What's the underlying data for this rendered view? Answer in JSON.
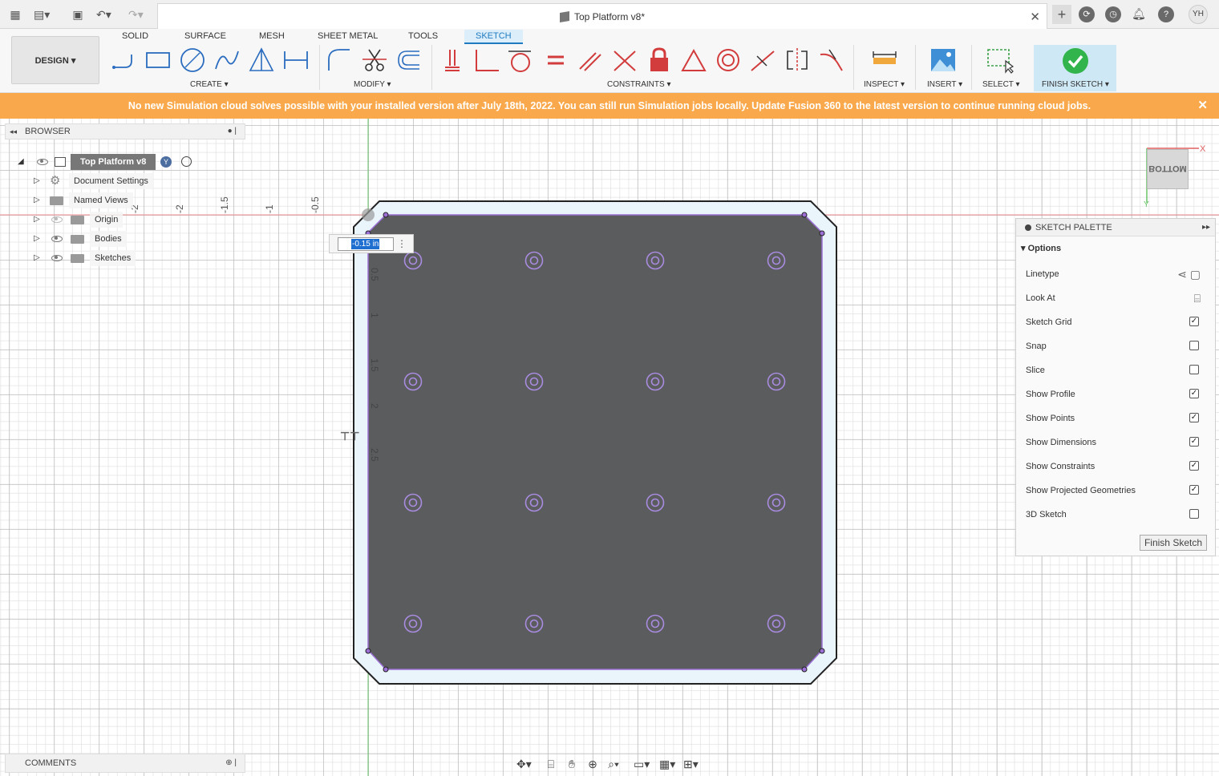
{
  "document": {
    "title": "Top Platform v8*"
  },
  "user": {
    "initials": "YH"
  },
  "workspace": {
    "mode": "DESIGN"
  },
  "tabs": [
    "SOLID",
    "SURFACE",
    "MESH",
    "SHEET METAL",
    "TOOLS",
    "SKETCH"
  ],
  "toolbar_groups": {
    "create": "CREATE",
    "modify": "MODIFY",
    "constraints": "CONSTRAINTS",
    "inspect": "INSPECT",
    "insert": "INSERT",
    "select": "SELECT",
    "finish": "FINISH SKETCH"
  },
  "banner": {
    "message": "No new Simulation cloud solves possible with your installed version after July 18th, 2022. You can still run Simulation jobs locally. Update Fusion 360 to the latest version to continue running cloud jobs."
  },
  "browser": {
    "title": "BROWSER",
    "root": "Top Platform v8",
    "items": [
      "Document Settings",
      "Named Views",
      "Origin",
      "Bodies",
      "Sketches"
    ]
  },
  "dimension_input": {
    "value": "-0.15 in"
  },
  "rulers": {
    "top": [
      "-2",
      "-2",
      "-1.5",
      "-1",
      "-0.5"
    ],
    "left": [
      "0.5",
      "1",
      "1.5",
      "2",
      "2.5"
    ]
  },
  "viewcube": {
    "face": "BOTTOM",
    "axis_x": "X",
    "axis_y": "Y"
  },
  "palette": {
    "title": "SKETCH PALETTE",
    "section": "Options",
    "rows": [
      {
        "label": "Linetype",
        "type": "icon",
        "icon": "linetype-icon"
      },
      {
        "label": "Look At",
        "type": "icon",
        "icon": "look-at-icon"
      },
      {
        "label": "Sketch Grid",
        "type": "check",
        "checked": true
      },
      {
        "label": "Snap",
        "type": "check",
        "checked": false
      },
      {
        "label": "Slice",
        "type": "check",
        "checked": false
      },
      {
        "label": "Show Profile",
        "type": "check",
        "checked": true
      },
      {
        "label": "Show Points",
        "type": "check",
        "checked": true
      },
      {
        "label": "Show Dimensions",
        "type": "check",
        "checked": true
      },
      {
        "label": "Show Constraints",
        "type": "check",
        "checked": true
      },
      {
        "label": "Show Projected Geometries",
        "type": "check",
        "checked": true
      },
      {
        "label": "3D Sketch",
        "type": "check",
        "checked": false
      }
    ],
    "finish_button": "Finish Sketch"
  },
  "comments": {
    "title": "COMMENTS"
  },
  "colors": {
    "accent": "#1f7bc1",
    "banner": "#f9a94b",
    "profile": "#5a5c5e",
    "sketch_line": "#9b6fd6",
    "finish": "#31b44b"
  }
}
